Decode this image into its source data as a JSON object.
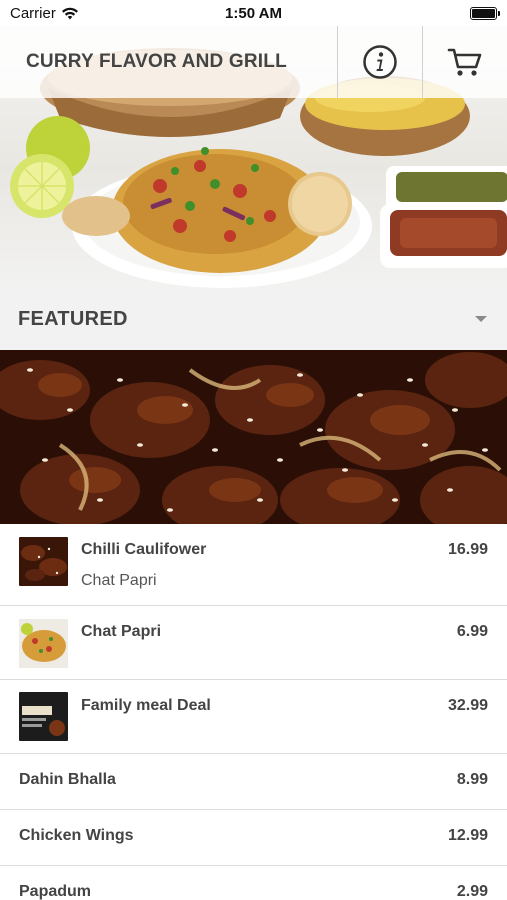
{
  "status_bar": {
    "carrier": "Carrier",
    "time": "1:50 AM",
    "icons": [
      "wifi-icon",
      "battery-icon"
    ]
  },
  "nav": {
    "title": "CURRY FLAVOR AND GRILL",
    "info_icon": "info-icon",
    "cart_icon": "cart-icon"
  },
  "section": {
    "title": "FEATURED",
    "toggle_icon": "chevron-down-icon"
  },
  "items": [
    {
      "name": "Chilli Caulifower",
      "subtitle": "Chat Papri",
      "price": "16.99",
      "thumb": "chilli-photo"
    },
    {
      "name": "Chat Papri",
      "price": "6.99",
      "thumb": "chat-papri-photo"
    },
    {
      "name": "Family meal Deal",
      "price": "32.99",
      "thumb": "family-meal-photo"
    },
    {
      "name": "Dahin Bhalla",
      "price": "8.99"
    },
    {
      "name": "Chicken Wings",
      "price": "12.99"
    },
    {
      "name": "Papadum",
      "price": "2.99"
    }
  ],
  "colors": {
    "header_bg": "#f2f2f2",
    "text": "#444444",
    "divider": "#dcdcdc"
  }
}
